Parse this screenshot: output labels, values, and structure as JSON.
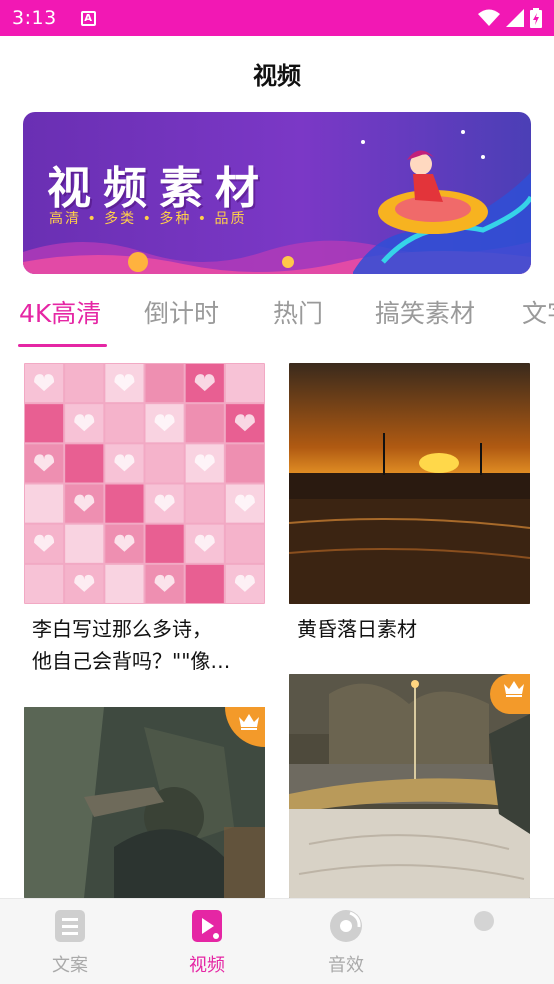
{
  "status": {
    "time": "3:13",
    "icon_a": "A"
  },
  "header": {
    "title": "视频"
  },
  "banner": {
    "title": "视频素材",
    "subtitle": "高清 • 多类 • 多种 • 品质"
  },
  "tabs": [
    {
      "label": "4K高清",
      "active": true
    },
    {
      "label": "倒计时"
    },
    {
      "label": "热门"
    },
    {
      "label": "搞笑素材"
    },
    {
      "label": "文字"
    }
  ],
  "cards": [
    {
      "title": "李白写过那么多诗，他自己会背吗？\"\"像…",
      "line1": "李白写过那么多诗，",
      "line2": "他自己会背吗？\"\"像…",
      "premium": false
    },
    {
      "title": "黄昏落日素材",
      "premium": false
    },
    {
      "title": "",
      "premium": true
    },
    {
      "title": "",
      "premium": true
    }
  ],
  "bottom_nav": [
    {
      "label": "文案",
      "icon": "document-icon",
      "active": false
    },
    {
      "label": "视频",
      "icon": "video-play-icon",
      "active": true
    },
    {
      "label": "音效",
      "icon": "music-disc-icon",
      "active": false
    }
  ],
  "colors": {
    "accent": "#e526a4",
    "status_bar": "#f218b4",
    "crown": "#f39a2a"
  }
}
